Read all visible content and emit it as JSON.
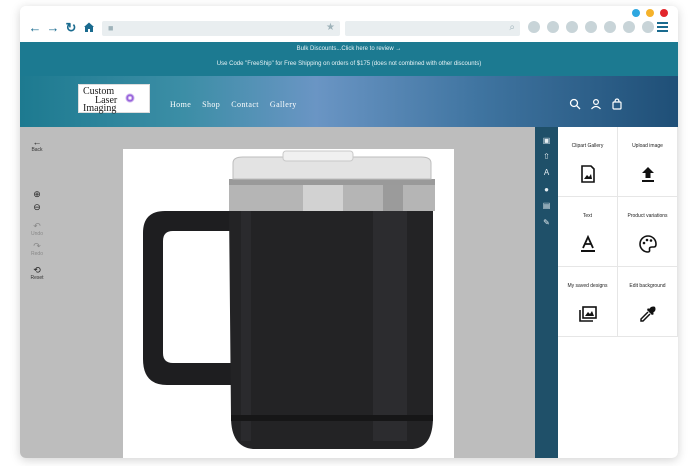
{
  "browser": {
    "dot_colors": [
      "#2ea7e0",
      "#f5b22b",
      "#e2262c"
    ],
    "back_icon": "arrow-left-icon",
    "forward_icon": "arrow-right-icon",
    "reload_icon": "reload-icon",
    "home_icon": "home-icon",
    "lock_icon": "lock-icon",
    "star_icon": "star-icon",
    "search_icon": "search-icon",
    "menu_icon": "hamburger-icon"
  },
  "announcement": {
    "line1": "Bulk Discounts...Click here to review  →",
    "line2": "Use Code \"FreeShip\" for Free Shipping on orders of $175 (does not combined with other discounts)"
  },
  "header": {
    "logo_lines": [
      "Custom",
      "Laser",
      "Imaging"
    ],
    "nav": [
      "Home",
      "Shop",
      "Contact",
      "Gallery"
    ],
    "icons": [
      "search-icon",
      "account-icon",
      "cart-icon"
    ]
  },
  "left_tools": {
    "back": "Back",
    "zoom_in_icon": "zoom-in-icon",
    "zoom_out_icon": "zoom-out-icon",
    "undo": "Undo",
    "redo": "Redo",
    "reset": "Reset"
  },
  "panel": {
    "items": [
      {
        "label": "Clipart Gallery",
        "icon": "image-icon"
      },
      {
        "label": "Upload image",
        "icon": "upload-icon"
      },
      {
        "label": "Text",
        "icon": "text-icon"
      },
      {
        "label": "Product variations",
        "icon": "palette-icon"
      },
      {
        "label": "My saved designs",
        "icon": "gallery-icon"
      },
      {
        "label": "Edit background",
        "icon": "eyedropper-icon"
      }
    ]
  },
  "colors": {
    "teal": "#1c7a91",
    "sidebar": "#1f5069",
    "mug": "#1c1c1e",
    "steel": "#b8b8b8"
  }
}
